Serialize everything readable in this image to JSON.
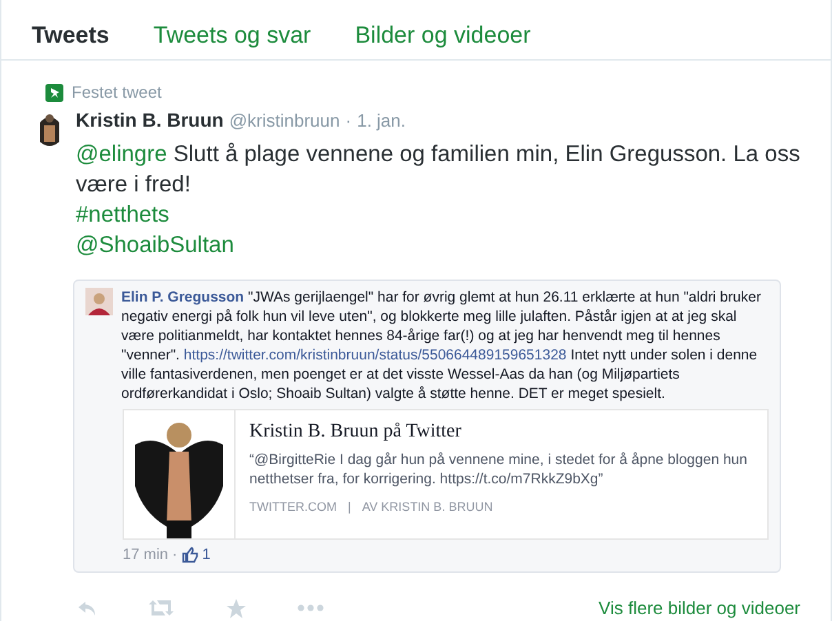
{
  "tabs": [
    {
      "label": "Tweets",
      "selected": true
    },
    {
      "label": "Tweets og svar",
      "selected": false
    },
    {
      "label": "Bilder og videoer",
      "selected": false
    }
  ],
  "pinned": {
    "label": "Festet tweet"
  },
  "tweet": {
    "author": "Kristin B. Bruun",
    "handle": "@kristinbruun",
    "separator": "·",
    "date": "1. jan.",
    "mention": "@elingre",
    "text": "Slutt å plage vennene og familien min, Elin Gregusson. La oss være i fred!",
    "tags": [
      "#netthets",
      "@ShoaibSultan"
    ]
  },
  "embed": {
    "author": "Elin P. Gregusson",
    "before_link": "\"JWAs gerijlaengel\" har for øvrig glemt at hun 26.11 erklærte at hun \"aldri bruker negativ energi på folk hun vil leve uten\", og blokkerte meg lille julaften. Påstår igjen at at jeg skal være politianmeldt, har kontaktet hennes 84-årige far(!) og at jeg har henvendt meg til hennes \"venner\".",
    "link": "https://twitter.com/kristinbruun/status/550664489159651328",
    "after_link": "Intet nytt under solen i denne ville fantasiverdenen, men poenget er at det visste Wessel-Aas da han (og Miljøpartiets ordførerkandidat i Oslo; Shoaib Sultan) valgte å støtte henne. DET er meget spesielt.",
    "card": {
      "title": "Kristin B. Bruun på Twitter",
      "quote": "“@BirgitteRie I dag går hun på vennene mine, i stedet for å åpne bloggen hun netthetser fra, for korrigering. https://t.co/m7RkkZ9bXg”",
      "domain": "TWITTER.COM",
      "divider": "|",
      "byline": "AV KRISTIN B. BRUUN"
    },
    "time": "17 min",
    "dot": "·",
    "likes": "1"
  },
  "more_link": "Vis flere bilder og videoer"
}
